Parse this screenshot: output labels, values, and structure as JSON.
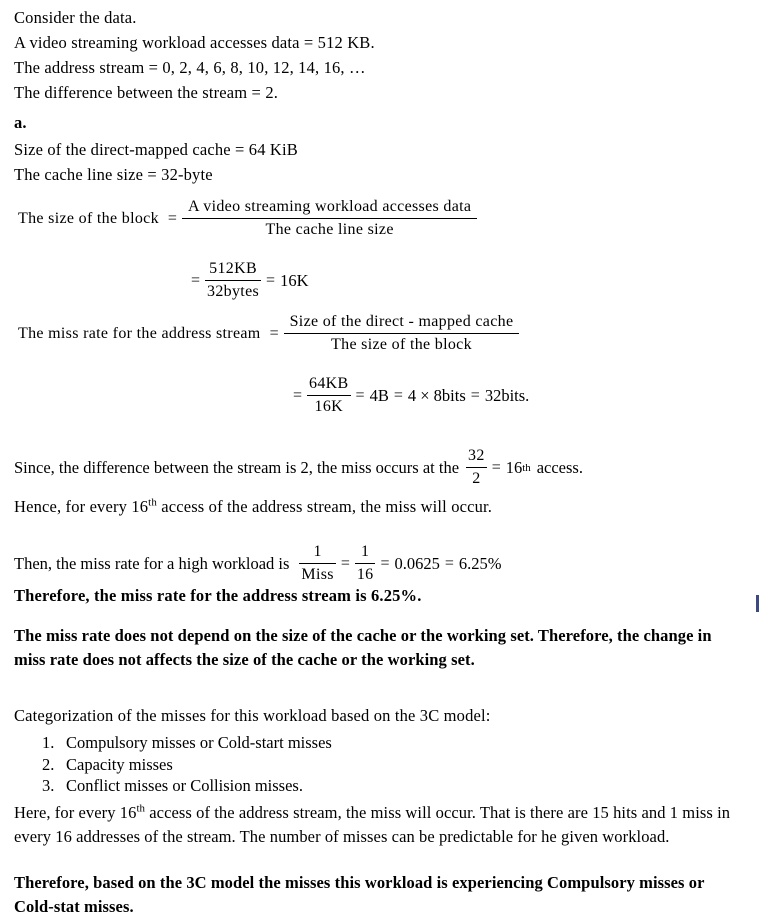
{
  "document": {
    "intro": {
      "line1": "Consider the data.",
      "line2": "A video streaming workload accesses data = 512 KB.",
      "line3": "The address stream = 0, 2, 4, 6, 8, 10, 12, 14, 16, …",
      "line4": "The difference between the stream = 2."
    },
    "part_a": {
      "label": "a.",
      "given1": "Size of the direct-mapped cache = 64 KiB",
      "given2": "The cache line size = 32-byte"
    },
    "equation_block_size": {
      "lead": "The size of the block",
      "equals": "=",
      "numerator": "A video streaming workload accesses data",
      "denominator": "The cache line size",
      "step2_equals": "=",
      "step2_numerator": "512KB",
      "step2_denominator": "32bytes",
      "step2_result_equals": "=",
      "step2_result": "16K"
    },
    "equation_miss_rate": {
      "lead": "The miss rate for the address stream",
      "equals": "=",
      "numerator": "Size of the direct - mapped cache",
      "denominator": "The size of the block",
      "step2_equals": "=",
      "step2_numerator": "64KB",
      "step2_denominator": "16K",
      "step2_result_equals": "=",
      "step2_result": "4B",
      "step3_equals": "=",
      "step3_result": "4 × 8bits",
      "step4_equals": "=",
      "step4_result": "32bits."
    },
    "since_line": {
      "prefix": "Since, the difference between the stream is 2, the miss occurs at the",
      "frac_num": "32",
      "frac_den": "2",
      "equals": "=",
      "value": "16",
      "ordinal": "th",
      "suffix": "access."
    },
    "hence_line": {
      "prefix": "Hence, for every 16",
      "ordinal": "th",
      "suffix": " access of the address stream, the miss will occur."
    },
    "then_line": {
      "prefix": "Then, the miss rate for a high workload is",
      "frac1_num": "1",
      "frac1_den": "Miss",
      "equals1": "=",
      "frac2_num": "1",
      "frac2_den": "16",
      "equals2": "=",
      "decimal": "0.0625",
      "equals3": "=",
      "percent": "6.25%"
    },
    "therefore_miss_rate": {
      "bold_part": "Therefore, the miss rate for the address stream is",
      "value": "6.25%."
    },
    "independence_note": "The miss rate does not depend on the size of the cache or the working set. Therefore, the change in miss rate does not affects the size of the cache or the working set.",
    "categorization_heading": "Categorization of the misses for this workload based on the 3C model:",
    "categorization_items": [
      {
        "index": "1.",
        "text": "Compulsory misses or Cold-start misses"
      },
      {
        "index": "2.",
        "text": "Capacity misses"
      },
      {
        "index": "3.",
        "text": "Conflict misses or Collision misses."
      }
    ],
    "here_paragraph": {
      "prefix": "Here, for every 16",
      "ordinal": "th",
      "suffix": " access of the address stream, the miss will occur. That is there are 15 hits and 1 miss in every 16 addresses of the stream. The number of misses can be predictable for he given workload."
    },
    "conclusion": "Therefore, based on the 3C model the misses this workload is experiencing Compulsory misses or Cold-stat misses.",
    "colors": {
      "text": "#000000",
      "background": "#ffffff",
      "artifact": "#1a2a6c"
    }
  }
}
